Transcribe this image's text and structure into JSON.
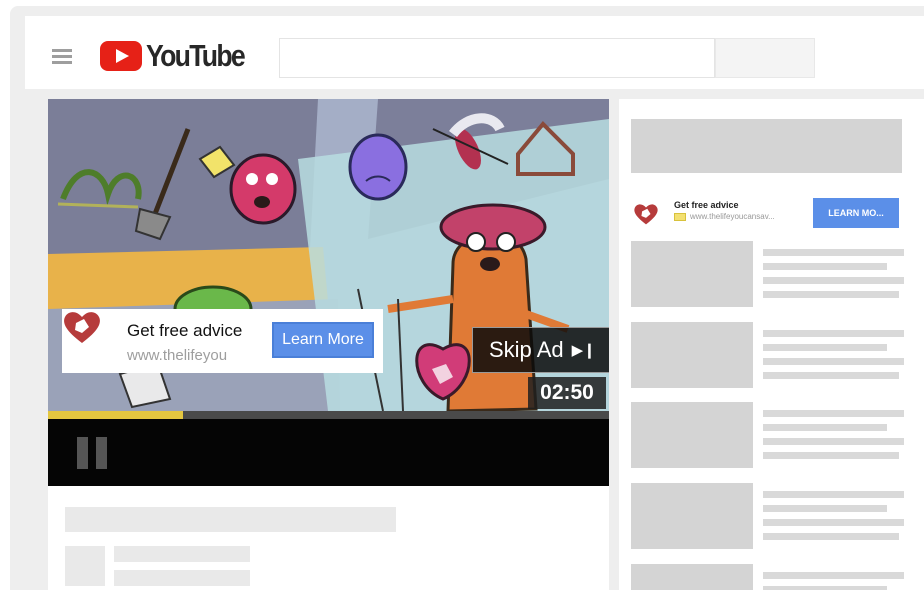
{
  "header": {
    "logo_text": "YouTube",
    "menu_icon": "hamburger-menu-icon",
    "logo_icon": "youtube-play-icon",
    "brand_color": "#e62117"
  },
  "player": {
    "ad_overlay": {
      "title": "Get free advice",
      "url": "www.thelifeyou",
      "cta": "Learn More",
      "logo_icon": "heart-hand-logo-icon"
    },
    "skip_ad": {
      "label": "Skip Ad",
      "icon": "skip-next-icon"
    },
    "time_remaining": "02:50",
    "progress_fraction": 0.24,
    "progress_color": "#e3c640",
    "pause_icon": "pause-icon"
  },
  "sidebar": {
    "ad": {
      "title": "Get free advice",
      "url": "www.thelifeyoucansav...",
      "cta": "LEARN MO...",
      "logo_icon": "heart-hand-logo-icon",
      "badge_icon": "ad-badge-icon"
    }
  },
  "colors": {
    "cta_blue": "#5b8fe8",
    "placeholder_gray": "#d4d4d4"
  }
}
